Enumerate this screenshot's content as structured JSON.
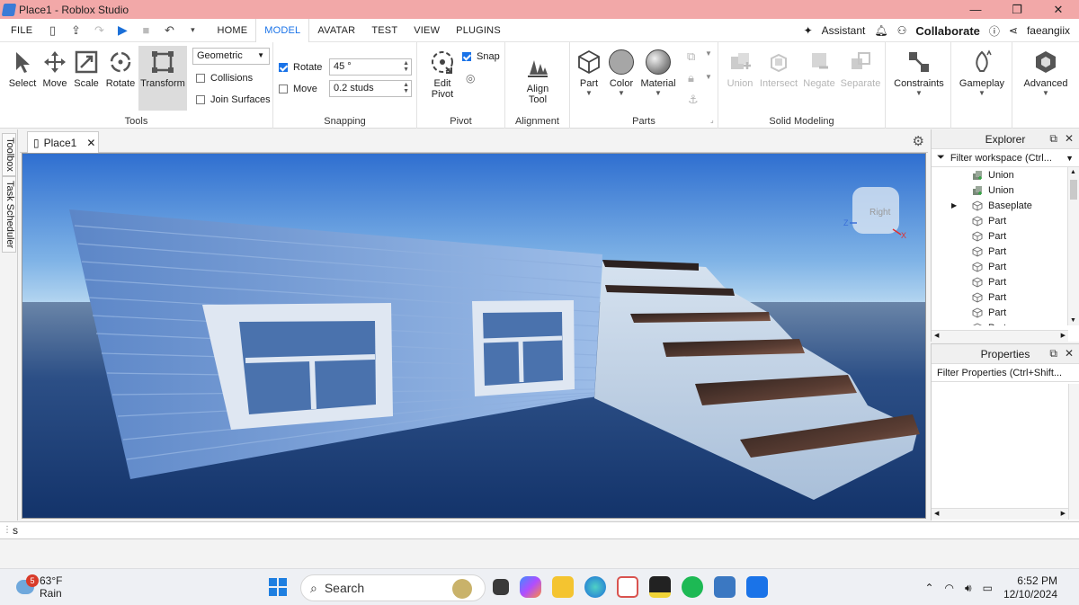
{
  "window": {
    "title": "Place1 - Roblox Studio",
    "controls": [
      "—",
      "❐",
      "✕"
    ]
  },
  "menu": {
    "file_label": "FILE",
    "tabs": [
      "HOME",
      "MODEL",
      "AVATAR",
      "TEST",
      "VIEW",
      "PLUGINS"
    ],
    "active_tab": "MODEL",
    "assistant_label": "Assistant",
    "collaborate_label": "Collaborate",
    "username": "faeangiix"
  },
  "ribbon": {
    "tools_group": {
      "label": "Tools",
      "select": "Select",
      "move": "Move",
      "scale": "Scale",
      "rotate": "Rotate",
      "transform": "Transform",
      "mode_value": "Geometric",
      "collisions": "Collisions",
      "join_surfaces": "Join Surfaces"
    },
    "snapping_group": {
      "label": "Snapping",
      "rotate_label": "Rotate",
      "rotate_value": "45 °",
      "rotate_checked": true,
      "move_label": "Move",
      "move_value": "0.2 studs",
      "move_checked": false
    },
    "pivot_group": {
      "label": "Pivot",
      "edit_pivot_line1": "Edit",
      "edit_pivot_line2": "Pivot",
      "snap_label": "Snap",
      "snap_checked": true
    },
    "alignment_group": {
      "label": "Alignment",
      "align_line1": "Align",
      "align_line2": "Tool"
    },
    "parts_group": {
      "label": "Parts",
      "part": "Part",
      "color": "Color",
      "material": "Material"
    },
    "solid_modeling_group": {
      "label": "Solid Modeling",
      "union": "Union",
      "intersect": "Intersect",
      "negate": "Negate",
      "separate": "Separate"
    },
    "constraints": "Constraints",
    "gameplay": "Gameplay",
    "advanced": "Advanced"
  },
  "side_tabs": [
    "Toolbox",
    "Task Scheduler"
  ],
  "document_tab": "Place1",
  "viewcube_label": "Right",
  "explorer": {
    "title": "Explorer",
    "filter_placeholder": "Filter workspace (Ctrl...",
    "items": [
      {
        "label": "Union",
        "icon": "union-icon",
        "expandable": false
      },
      {
        "label": "Union",
        "icon": "union-icon",
        "expandable": false
      },
      {
        "label": "Baseplate",
        "icon": "part-icon",
        "expandable": true
      },
      {
        "label": "Part",
        "icon": "part-icon",
        "expandable": false
      },
      {
        "label": "Part",
        "icon": "part-icon",
        "expandable": false
      },
      {
        "label": "Part",
        "icon": "part-icon",
        "expandable": false
      },
      {
        "label": "Part",
        "icon": "part-icon",
        "expandable": false
      },
      {
        "label": "Part",
        "icon": "part-icon",
        "expandable": false
      },
      {
        "label": "Part",
        "icon": "part-icon",
        "expandable": false
      },
      {
        "label": "Part",
        "icon": "part-icon",
        "expandable": false
      },
      {
        "label": "Part",
        "icon": "part-icon",
        "expandable": false
      }
    ]
  },
  "properties": {
    "title": "Properties",
    "filter_placeholder": "Filter Properties (Ctrl+Shift..."
  },
  "command_bar": {
    "value": "s"
  },
  "taskbar": {
    "weather_temp": "63°F",
    "weather_desc": "Rain",
    "weather_badge": "5",
    "search_placeholder": "Search",
    "time": "6:52 PM",
    "date": "12/10/2024"
  },
  "colors": {
    "titlebar": "#f2a8a8",
    "accent": "#1a73e8",
    "sky_top": "#2f6fd0",
    "sky_bottom": "#a9d0ef",
    "wall": "#7aa1d8",
    "stairs": "#b9cbe0",
    "step_tops": "#3a2b26"
  }
}
